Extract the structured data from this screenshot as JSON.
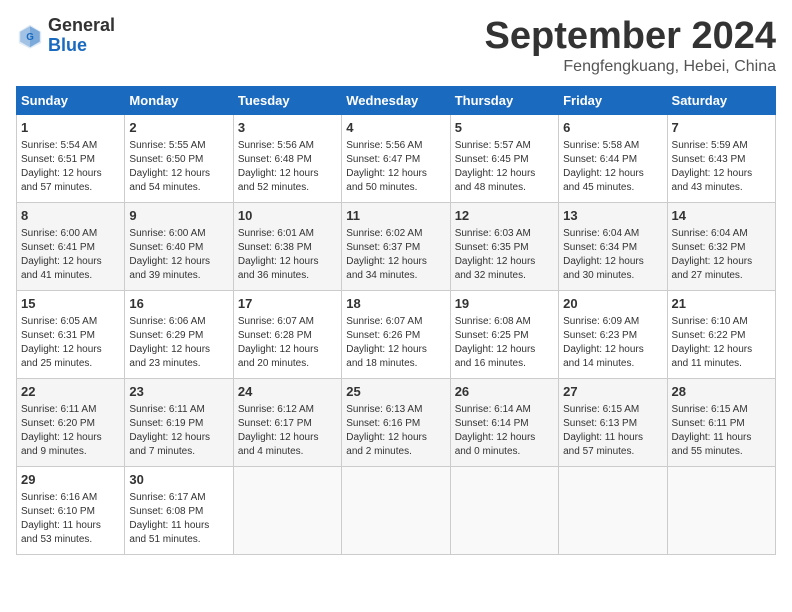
{
  "header": {
    "logo_general": "General",
    "logo_blue": "Blue",
    "month_title": "September 2024",
    "location": "Fengfengkuang, Hebei, China"
  },
  "days_of_week": [
    "Sunday",
    "Monday",
    "Tuesday",
    "Wednesday",
    "Thursday",
    "Friday",
    "Saturday"
  ],
  "weeks": [
    [
      {
        "day": "1",
        "info": "Sunrise: 5:54 AM\nSunset: 6:51 PM\nDaylight: 12 hours\nand 57 minutes."
      },
      {
        "day": "2",
        "info": "Sunrise: 5:55 AM\nSunset: 6:50 PM\nDaylight: 12 hours\nand 54 minutes."
      },
      {
        "day": "3",
        "info": "Sunrise: 5:56 AM\nSunset: 6:48 PM\nDaylight: 12 hours\nand 52 minutes."
      },
      {
        "day": "4",
        "info": "Sunrise: 5:56 AM\nSunset: 6:47 PM\nDaylight: 12 hours\nand 50 minutes."
      },
      {
        "day": "5",
        "info": "Sunrise: 5:57 AM\nSunset: 6:45 PM\nDaylight: 12 hours\nand 48 minutes."
      },
      {
        "day": "6",
        "info": "Sunrise: 5:58 AM\nSunset: 6:44 PM\nDaylight: 12 hours\nand 45 minutes."
      },
      {
        "day": "7",
        "info": "Sunrise: 5:59 AM\nSunset: 6:43 PM\nDaylight: 12 hours\nand 43 minutes."
      }
    ],
    [
      {
        "day": "8",
        "info": "Sunrise: 6:00 AM\nSunset: 6:41 PM\nDaylight: 12 hours\nand 41 minutes."
      },
      {
        "day": "9",
        "info": "Sunrise: 6:00 AM\nSunset: 6:40 PM\nDaylight: 12 hours\nand 39 minutes."
      },
      {
        "day": "10",
        "info": "Sunrise: 6:01 AM\nSunset: 6:38 PM\nDaylight: 12 hours\nand 36 minutes."
      },
      {
        "day": "11",
        "info": "Sunrise: 6:02 AM\nSunset: 6:37 PM\nDaylight: 12 hours\nand 34 minutes."
      },
      {
        "day": "12",
        "info": "Sunrise: 6:03 AM\nSunset: 6:35 PM\nDaylight: 12 hours\nand 32 minutes."
      },
      {
        "day": "13",
        "info": "Sunrise: 6:04 AM\nSunset: 6:34 PM\nDaylight: 12 hours\nand 30 minutes."
      },
      {
        "day": "14",
        "info": "Sunrise: 6:04 AM\nSunset: 6:32 PM\nDaylight: 12 hours\nand 27 minutes."
      }
    ],
    [
      {
        "day": "15",
        "info": "Sunrise: 6:05 AM\nSunset: 6:31 PM\nDaylight: 12 hours\nand 25 minutes."
      },
      {
        "day": "16",
        "info": "Sunrise: 6:06 AM\nSunset: 6:29 PM\nDaylight: 12 hours\nand 23 minutes."
      },
      {
        "day": "17",
        "info": "Sunrise: 6:07 AM\nSunset: 6:28 PM\nDaylight: 12 hours\nand 20 minutes."
      },
      {
        "day": "18",
        "info": "Sunrise: 6:07 AM\nSunset: 6:26 PM\nDaylight: 12 hours\nand 18 minutes."
      },
      {
        "day": "19",
        "info": "Sunrise: 6:08 AM\nSunset: 6:25 PM\nDaylight: 12 hours\nand 16 minutes."
      },
      {
        "day": "20",
        "info": "Sunrise: 6:09 AM\nSunset: 6:23 PM\nDaylight: 12 hours\nand 14 minutes."
      },
      {
        "day": "21",
        "info": "Sunrise: 6:10 AM\nSunset: 6:22 PM\nDaylight: 12 hours\nand 11 minutes."
      }
    ],
    [
      {
        "day": "22",
        "info": "Sunrise: 6:11 AM\nSunset: 6:20 PM\nDaylight: 12 hours\nand 9 minutes."
      },
      {
        "day": "23",
        "info": "Sunrise: 6:11 AM\nSunset: 6:19 PM\nDaylight: 12 hours\nand 7 minutes."
      },
      {
        "day": "24",
        "info": "Sunrise: 6:12 AM\nSunset: 6:17 PM\nDaylight: 12 hours\nand 4 minutes."
      },
      {
        "day": "25",
        "info": "Sunrise: 6:13 AM\nSunset: 6:16 PM\nDaylight: 12 hours\nand 2 minutes."
      },
      {
        "day": "26",
        "info": "Sunrise: 6:14 AM\nSunset: 6:14 PM\nDaylight: 12 hours\nand 0 minutes."
      },
      {
        "day": "27",
        "info": "Sunrise: 6:15 AM\nSunset: 6:13 PM\nDaylight: 11 hours\nand 57 minutes."
      },
      {
        "day": "28",
        "info": "Sunrise: 6:15 AM\nSunset: 6:11 PM\nDaylight: 11 hours\nand 55 minutes."
      }
    ],
    [
      {
        "day": "29",
        "info": "Sunrise: 6:16 AM\nSunset: 6:10 PM\nDaylight: 11 hours\nand 53 minutes."
      },
      {
        "day": "30",
        "info": "Sunrise: 6:17 AM\nSunset: 6:08 PM\nDaylight: 11 hours\nand 51 minutes."
      },
      {
        "day": "",
        "info": ""
      },
      {
        "day": "",
        "info": ""
      },
      {
        "day": "",
        "info": ""
      },
      {
        "day": "",
        "info": ""
      },
      {
        "day": "",
        "info": ""
      }
    ]
  ]
}
